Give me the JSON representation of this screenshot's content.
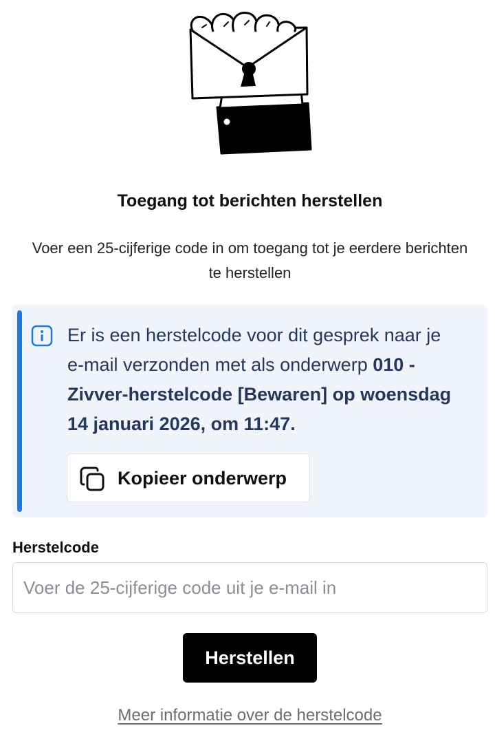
{
  "illustration": {
    "icon": "hand-holding-locked-envelope-illustration"
  },
  "title": "Toegang tot berichten herstellen",
  "subtitle": "Voer een 25-cijferige code in om toegang tot je eerdere berichten te herstellen",
  "info": {
    "icon": "info-icon",
    "accent_color": "#1e78e6",
    "background_color": "#f0f4fb",
    "text_color": "#23385c",
    "text_intro": "Er is een herstelcode voor dit gesprek naar je e-mail verzonden met als onderwerp ",
    "text_subject": "010 - Zivver-herstelcode [Bewaren] op woensdag 14 januari 2026, om 11:47.",
    "copy_button": {
      "icon": "copy-icon",
      "label": "Kopieer onderwerp"
    }
  },
  "form": {
    "label": "Herstelcode",
    "input_value": "",
    "input_placeholder": "Voer de 25-cijferige code uit je e-mail in",
    "submit_label": "Herstellen"
  },
  "more_info_link": "Meer informatie over de herstelcode"
}
